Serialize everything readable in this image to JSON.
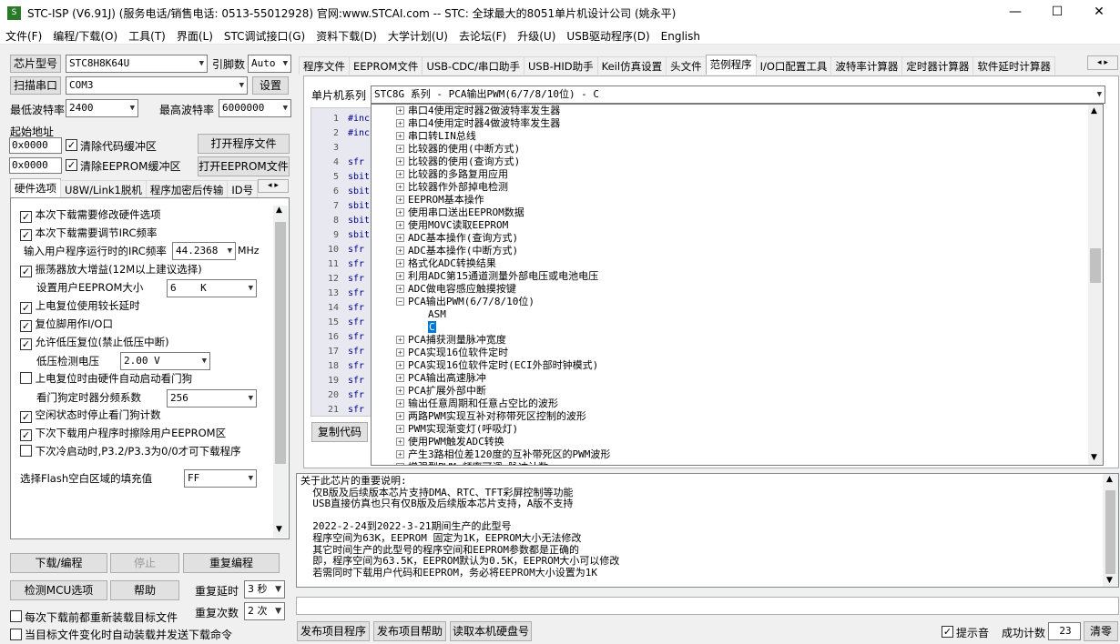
{
  "window": {
    "title": "STC-ISP (V6.91J) (服务电话/销售电话: 0513-55012928) 官网:www.STCAI.com  -- STC: 全球最大的8051单片机设计公司 (姚永平)",
    "minimize": "—",
    "maximize": "☐",
    "close": "✕"
  },
  "menu": [
    "文件(F)",
    "编程/下载(O)",
    "工具(T)",
    "界面(L)",
    "STC调试接口(G)",
    "资料下载(D)",
    "大学计划(U)",
    "去论坛(F)",
    "升级(U)",
    "USB驱动程序(D)",
    "English"
  ],
  "left": {
    "chip_label": "芯片型号",
    "chip_value": "STC8H8K64U",
    "pins_label": "引脚数",
    "pins_value": "Auto",
    "scan_button": "扫描串口",
    "port_value": "COM3",
    "settings_button": "设置",
    "min_baud_label": "最低波特率",
    "min_baud_value": "2400",
    "max_baud_label": "最高波特率",
    "max_baud_value": "6000000",
    "start_addr_label": "起始地址",
    "addr1": "0x0000",
    "clear_code_label": "清除代码缓冲区",
    "open_prog_button": "打开程序文件",
    "addr2": "0x0000",
    "clear_eeprom_label": "清除EEPROM缓冲区",
    "open_eeprom_button": "打开EEPROM文件",
    "tabs": [
      "硬件选项",
      "U8W/Link1脱机",
      "程序加密后传输",
      "ID号"
    ],
    "options": {
      "opt1": "本次下载需要修改硬件选项",
      "opt2": "本次下载需要调节IRC频率",
      "irc_label": "输入用户程序运行时的IRC频率",
      "irc_value": "44.2368",
      "irc_unit": "MHz",
      "opt3": "振荡器放大增益(12M以上建议选择)",
      "eeprom_size_label": "设置用户EEPROM大小",
      "eeprom_size_value": "6    K",
      "opt4": "上电复位使用较长延时",
      "opt5": "复位脚用作I/O口",
      "opt6": "允许低压复位(禁止低压中断)",
      "lvd_label": "低压检测电压",
      "lvd_value": "2.00 V",
      "opt7": "上电复位时由硬件自动启动看门狗",
      "wdt_label": "看门狗定时器分频系数",
      "wdt_value": "256",
      "opt8": "空闲状态时停止看门狗计数",
      "opt9": "下次下载用户程序时擦除用户EEPROM区",
      "opt10": "下次冷启动时,P3.2/P3.3为0/0才可下载程序",
      "fill_label": "选择Flash空白区域的填充值",
      "fill_value": "FF"
    },
    "download_button": "下载/编程",
    "stop_button": "停止",
    "reprogram_button": "重复编程",
    "detect_button": "检测MCU选项",
    "help_button": "帮助",
    "repeat_delay_label": "重复延时",
    "repeat_delay_value": "3 秒",
    "repeat_count_label": "重复次数",
    "repeat_count_value": "2 次",
    "reload_label": "每次下载前都重新装载目标文件",
    "autosend_label": "当目标文件变化时自动装载并发送下载命令"
  },
  "right": {
    "tabs": [
      "程序文件",
      "EEPROM文件",
      "USB-CDC/串口助手",
      "USB-HID助手",
      "Keil仿真设置",
      "头文件",
      "范例程序",
      "I/O口配置工具",
      "波特率计算器",
      "定时器计算器",
      "软件延时计算器"
    ],
    "series_label": "单片机系列",
    "series_value": "STC8G 系列 - PCA输出PWM(6/7/8/10位) - C",
    "code_lines": [
      {
        "n": "1",
        "t": "#inc"
      },
      {
        "n": "2",
        "t": "#inc"
      },
      {
        "n": "3",
        "t": ""
      },
      {
        "n": "4",
        "t": "sfr"
      },
      {
        "n": "5",
        "t": "sbit"
      },
      {
        "n": "6",
        "t": "sbit"
      },
      {
        "n": "7",
        "t": "sbit"
      },
      {
        "n": "8",
        "t": "sbit"
      },
      {
        "n": "9",
        "t": "sbit"
      },
      {
        "n": "10",
        "t": "sfr"
      },
      {
        "n": "11",
        "t": "sfr"
      },
      {
        "n": "12",
        "t": "sfr"
      },
      {
        "n": "13",
        "t": "sfr"
      },
      {
        "n": "14",
        "t": "sfr"
      },
      {
        "n": "15",
        "t": "sfr"
      },
      {
        "n": "16",
        "t": "sfr"
      },
      {
        "n": "17",
        "t": "sfr"
      },
      {
        "n": "18",
        "t": "sfr"
      },
      {
        "n": "19",
        "t": "sfr"
      },
      {
        "n": "20",
        "t": "sfr"
      },
      {
        "n": "21",
        "t": "sfr"
      }
    ],
    "copy_button": "复制代码",
    "tree": [
      {
        "t": "串口4使用定时器2做波特率发生器",
        "s": "+"
      },
      {
        "t": "串口4使用定时器4做波特率发生器",
        "s": "+"
      },
      {
        "t": "串口转LIN总线",
        "s": "+"
      },
      {
        "t": "比较器的使用(中断方式)",
        "s": "+"
      },
      {
        "t": "比较器的使用(查询方式)",
        "s": "+"
      },
      {
        "t": "比较器的多路复用应用",
        "s": "+"
      },
      {
        "t": "比较器作外部掉电检测",
        "s": "+"
      },
      {
        "t": "EEPROM基本操作",
        "s": "+"
      },
      {
        "t": "使用串口送出EEPROM数据",
        "s": "+"
      },
      {
        "t": "使用MOVC读取EEPROM",
        "s": "+"
      },
      {
        "t": "ADC基本操作(查询方式)",
        "s": "+"
      },
      {
        "t": "ADC基本操作(中断方式)",
        "s": "+"
      },
      {
        "t": "格式化ADC转换结果",
        "s": "+"
      },
      {
        "t": "利用ADC第15通道测量外部电压或电池电压",
        "s": "+"
      },
      {
        "t": "ADC做电容感应触摸按键",
        "s": "+"
      },
      {
        "t": "PCA输出PWM(6/7/8/10位)",
        "s": "-"
      },
      {
        "t": "ASM",
        "s": "child"
      },
      {
        "t": "C",
        "s": "selected"
      },
      {
        "t": "PCA捕获测量脉冲宽度",
        "s": "+"
      },
      {
        "t": "PCA实现16位软件定时",
        "s": "+"
      },
      {
        "t": "PCA实现16位软件定时(ECI外部时钟模式)",
        "s": "+"
      },
      {
        "t": "PCA输出高速脉冲",
        "s": "+"
      },
      {
        "t": "PCA扩展外部中断",
        "s": "+"
      },
      {
        "t": "输出任意周期和任意占空比的波形",
        "s": "+"
      },
      {
        "t": "两路PWM实现互补对称带死区控制的波形",
        "s": "+"
      },
      {
        "t": "PWM实现渐变灯(呼吸灯)",
        "s": "+"
      },
      {
        "t": "使用PWM触发ADC转换",
        "s": "+"
      },
      {
        "t": "产生3路相位差120度的互补带死区的PWM波形",
        "s": "+"
      },
      {
        "t": "增强型PWM 频率可调 脉冲计数",
        "s": "+"
      }
    ],
    "info_text": "关于此芯片的重要说明:\n  仅B版及后续版本芯片支持DMA、RTC、TFT彩屏控制等功能\n  USB直接仿真也只有仅B版及后续版本芯片支持，A版不支持\n\n  2022-2-24到2022-3-21期间生产的此型号\n  程序空间为63K，EEPROM 固定为1K，EEPROM大小无法修改\n  其它时间生产的此型号的程序空间和EEPROM参数都是正确的\n  即，程序空间为63.5K，EEPROM默认为0.5K，EEPROM大小可以修改\n  若需同时下载用户代码和EEPROM，务必将EEPROM大小设置为1K",
    "publish_prog_button": "发布项目程序",
    "publish_help_button": "发布项目帮助",
    "read_disk_button": "读取本机硬盘号",
    "beep_label": "提示音",
    "success_label": "成功计数",
    "success_value": "23",
    "clear_button": "清零"
  },
  "colors": {
    "selected_bg": "#0078d7",
    "code_bg": "#e8e8f0"
  }
}
